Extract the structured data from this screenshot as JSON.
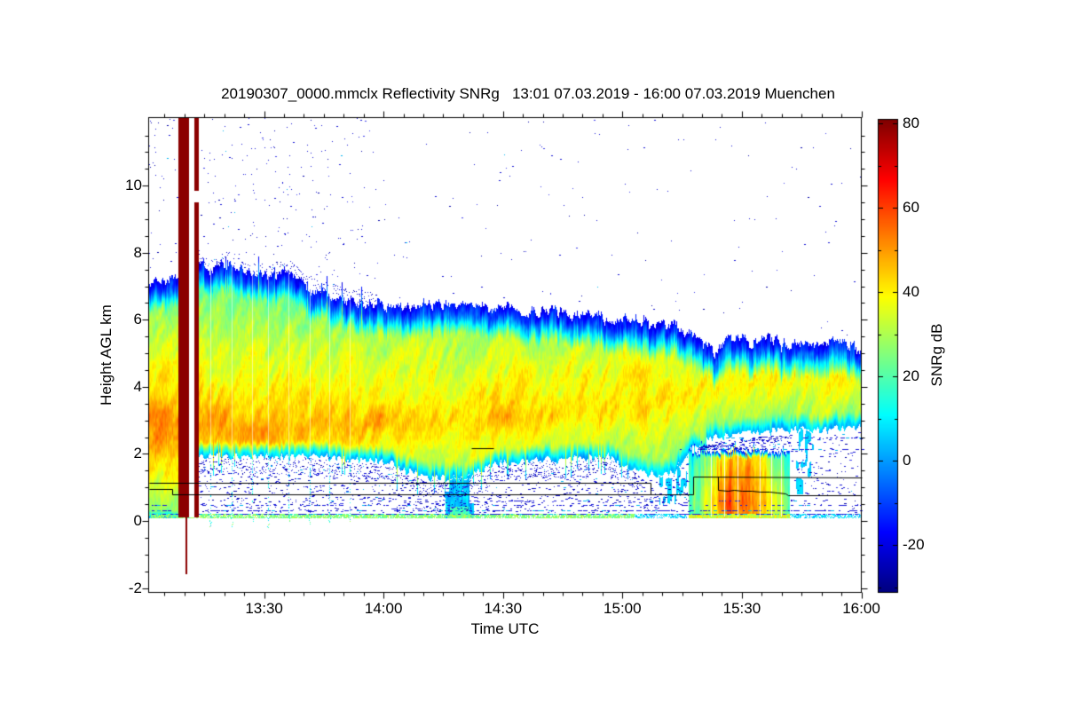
{
  "chart_data": {
    "type": "heatmap",
    "title": "20190307_0000.mmclx Reflectivity SNRg   13:01 07.03.2019 - 16:00 07.03.2019 Muenchen",
    "xlabel": "Time UTC",
    "ylabel": "Height AGL km",
    "x_axis": {
      "start_label": "13:01",
      "end_label": "16:00",
      "span_minutes": 179,
      "minor_tick_minutes": 5,
      "ticks": [
        {
          "minute": 29,
          "label": "13:30"
        },
        {
          "minute": 59,
          "label": "14:00"
        },
        {
          "minute": 89,
          "label": "14:30"
        },
        {
          "minute": 119,
          "label": "15:00"
        },
        {
          "minute": 149,
          "label": "15:30"
        },
        {
          "minute": 179,
          "label": "16:00"
        }
      ]
    },
    "y_axis": {
      "min_km": -2.13,
      "max_km": 12.03,
      "minor_tick_km": 0.5,
      "ticks": [
        {
          "km": 10,
          "label": "10"
        },
        {
          "km": 8,
          "label": "8"
        },
        {
          "km": 6,
          "label": "6"
        },
        {
          "km": 4,
          "label": "4"
        },
        {
          "km": 2,
          "label": "2"
        },
        {
          "km": 0,
          "label": "0"
        },
        {
          "km": -2,
          "label": "-2"
        }
      ]
    },
    "colorbar": {
      "label": "SNRg dB",
      "colormap": "jet",
      "min_db": -31,
      "max_db": 81,
      "minor_tick_db": 10,
      "ticks": [
        {
          "db": 80,
          "label": "80"
        },
        {
          "db": 60,
          "label": "60"
        },
        {
          "db": 40,
          "label": "40"
        },
        {
          "db": 20,
          "label": "20"
        },
        {
          "db": 0,
          "label": "0"
        },
        {
          "db": -20,
          "label": "-20"
        }
      ]
    },
    "colors": {
      "no_signal_gray": "#9b9b9b",
      "calibration_stripe": "#8b0000",
      "speckle_blue": "#1414d2",
      "speckle_cyan": "#00b4f0",
      "line_black": "#000000",
      "background": "#ffffff"
    },
    "data_floor_km": 0.1,
    "series": {
      "time_minutes": [
        0,
        4,
        7,
        9,
        12,
        15,
        20,
        25,
        30,
        35,
        40,
        45,
        50,
        55,
        60,
        65,
        70,
        75,
        80,
        85,
        90,
        95,
        100,
        105,
        110,
        115,
        120,
        124,
        128,
        132,
        136,
        139,
        142,
        145,
        148,
        152,
        156,
        160,
        164,
        168,
        172,
        176,
        179
      ],
      "cloud_top_km": [
        7.2,
        7.2,
        7.3,
        7.6,
        7.8,
        7.5,
        7.7,
        7.4,
        7.3,
        7.5,
        7.0,
        6.8,
        6.6,
        6.5,
        6.5,
        6.4,
        6.55,
        6.4,
        6.45,
        6.3,
        6.35,
        6.2,
        6.3,
        6.15,
        6.2,
        6.0,
        6.1,
        5.95,
        5.9,
        5.85,
        5.6,
        5.3,
        4.95,
        5.4,
        5.5,
        5.3,
        5.5,
        5.2,
        5.4,
        5.25,
        5.35,
        5.2,
        5.1
      ],
      "cloud_base_km": [
        0.1,
        0.1,
        0.1,
        0.35,
        1.9,
        1.95,
        1.95,
        1.9,
        1.95,
        1.9,
        1.95,
        1.9,
        1.85,
        1.8,
        1.75,
        1.5,
        1.3,
        1.25,
        1.3,
        1.65,
        1.75,
        1.8,
        1.85,
        1.8,
        1.9,
        1.95,
        1.6,
        1.45,
        1.35,
        1.5,
        2.1,
        2.4,
        2.5,
        2.55,
        2.6,
        2.65,
        2.7,
        2.7,
        2.75,
        2.7,
        2.75,
        2.8,
        2.8
      ],
      "peak_height_km": [
        2.7,
        2.7,
        2.7,
        2.7,
        2.7,
        2.7,
        2.7,
        2.7,
        2.65,
        2.7,
        2.75,
        2.8,
        2.8,
        2.85,
        2.9,
        2.95,
        3.0,
        3.0,
        3.0,
        3.05,
        3.1,
        3.1,
        3.15,
        3.2,
        3.3,
        3.4,
        3.5,
        3.6,
        3.6,
        3.7,
        3.8,
        4.0,
        4.1,
        4.2,
        4.2,
        4.3,
        4.3,
        4.35,
        4.4,
        4.35,
        4.4,
        4.4,
        4.4
      ],
      "peak_snr_db": [
        48,
        48,
        47,
        46,
        46,
        46,
        47,
        46,
        45,
        46,
        45,
        44,
        44,
        43,
        43,
        43,
        43,
        42,
        42,
        43,
        43,
        43,
        42,
        42,
        42,
        42,
        43,
        43,
        42,
        41,
        40,
        39,
        38,
        39,
        40,
        40,
        40,
        39,
        40,
        40,
        40,
        39,
        39
      ]
    },
    "features": {
      "calibration_stripes": [
        {
          "start_minute": 7.36,
          "end_minute": 10.25
        },
        {
          "start_minute": 11.37,
          "end_minute": 12.7,
          "break_km": [
            9.5,
            9.85
          ]
        }
      ],
      "white_gap_minutes": [
        10.25,
        11.37
      ],
      "below_ground_line": {
        "minute": 9.5,
        "from_km": 0.1,
        "to_km": -1.6
      },
      "interference_streaks": [
        {
          "minute": 0.9,
          "to_km": 10.2
        },
        {
          "minute": 15.6
        },
        {
          "minute": 20.95
        },
        {
          "minute": 26.08
        },
        {
          "minute": 30.09
        },
        {
          "minute": 35.22
        },
        {
          "minute": 40.57
        },
        {
          "minute": 45.47
        },
        {
          "minute": 50.38
        }
      ],
      "shower": {
        "start_minute": 135.5,
        "end_minute": 161,
        "top_km": 2.08,
        "base_km": 0.1,
        "strength_t": [
          135.5,
          137,
          139,
          141,
          143,
          146,
          150,
          153,
          155.5,
          158,
          160,
          161
        ],
        "strength": [
          0.3,
          0.42,
          0.55,
          0.62,
          0.85,
          1,
          1,
          0.92,
          0.72,
          0.6,
          0.45,
          0.3
        ],
        "core_peak_height_km": 0.55,
        "core_max_snr_db": 56,
        "white_gap_minutes": [
          141.2,
          144.6,
          147.9,
          153.4,
          156.4,
          158.9
        ]
      },
      "precip_shaft": {
        "start_minute": 74.5,
        "end_minute": 81.5,
        "to_km": 0.15
      },
      "virga": [
        {
          "start_minute": 128,
          "end_minute": 135.3,
          "depth_km": 0.9
        },
        {
          "start_minute": 162.5,
          "end_minute": 167,
          "to_km": 0.8
        }
      ],
      "black_lines": {
        "line_a": [
          [
            0,
            1.135
          ],
          [
            126,
            1.135
          ],
          [
            126,
            0.8
          ],
          [
            136.7,
            0.8
          ],
          [
            136.7,
            1.33
          ],
          [
            179,
            1.3
          ]
        ],
        "line_b": [
          [
            0,
            0.95
          ],
          [
            6,
            0.95
          ],
          [
            6,
            0.79
          ],
          [
            126,
            0.79
          ]
        ],
        "line_c": [
          [
            143,
            1.33
          ],
          [
            143,
            0.93
          ],
          [
            145.5,
            0.9
          ],
          [
            147,
            0.93
          ],
          [
            149,
            0.89
          ],
          [
            151.5,
            0.91
          ],
          [
            153.5,
            0.87
          ],
          [
            156,
            0.88
          ],
          [
            158,
            0.85
          ],
          [
            160,
            0.83
          ],
          [
            160.5,
            0.78
          ],
          [
            179,
            0.78
          ]
        ],
        "segment_2km": [
          [
            81,
            2.17
          ],
          [
            86.5,
            2.17
          ]
        ]
      },
      "clutter_dash_lines": [
        {
          "km": 0.2,
          "density": 0.7,
          "cyan": true,
          "start": 0,
          "end": 179
        },
        {
          "km": 0.33,
          "density": 0.55,
          "start": 0,
          "end": 179
        },
        {
          "km": 0.47,
          "density": 0.35,
          "start": 0,
          "end": 179
        },
        {
          "km": 0.62,
          "density": 0.18,
          "start": 55,
          "end": 179
        }
      ],
      "elevated_dash_lines": [
        {
          "km": 2.48,
          "density": 0.45,
          "start": 145,
          "end": 179
        },
        {
          "km": 2.14,
          "density": 0.3,
          "start": 132,
          "end": 179
        }
      ]
    }
  }
}
